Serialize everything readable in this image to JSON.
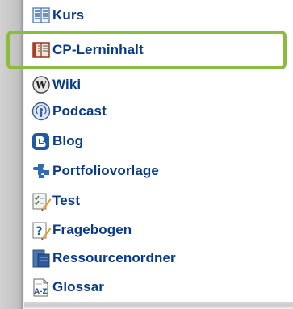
{
  "menu": {
    "items": [
      {
        "label": "Kurs",
        "icon": "course-icon"
      },
      {
        "label": "CP-Lerninhalt",
        "icon": "cp-learning-content-icon"
      },
      {
        "label": "Wiki",
        "icon": "wiki-icon"
      },
      {
        "label": "Podcast",
        "icon": "podcast-icon"
      },
      {
        "label": "Blog",
        "icon": "blog-icon"
      },
      {
        "label": "Portfoliovorlage",
        "icon": "portfolio-template-icon"
      },
      {
        "label": "Test",
        "icon": "test-icon"
      },
      {
        "label": "Fragebogen",
        "icon": "questionnaire-icon"
      },
      {
        "label": "Ressourcenordner",
        "icon": "resource-folder-icon"
      },
      {
        "label": "Glossar",
        "icon": "glossary-icon"
      }
    ],
    "highlighted_item": "CP-Lerninhalt"
  },
  "colors": {
    "link": "#083a88",
    "highlight_border": "#8dbb3e"
  }
}
